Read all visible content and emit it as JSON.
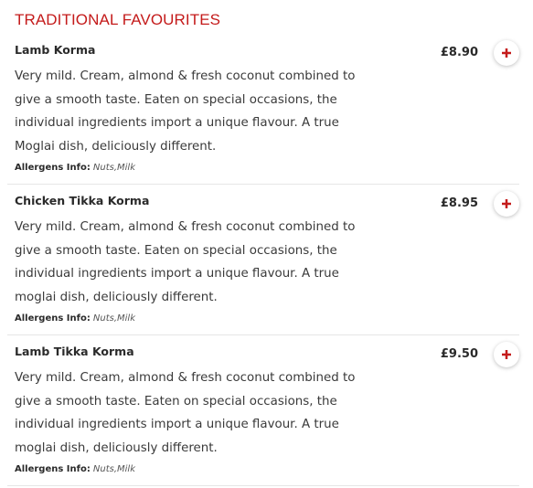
{
  "section": {
    "title": "TRADITIONAL FAVOURITES"
  },
  "accent_color": "#c41b1b",
  "items": [
    {
      "name": "Lamb Korma",
      "price": "£8.90",
      "description": "Very mild. Cream, almond & fresh coconut combined to give a smooth taste. Eaten on special occasions, the individual ingredients import a unique flavour. A true Moglai dish, deliciously different.",
      "allergens_label": "Allergens Info:",
      "allergens": "Nuts,Milk",
      "add_icon": "plus-icon"
    },
    {
      "name": "Chicken Tikka Korma",
      "price": "£8.95",
      "description": "Very mild. Cream, almond & fresh coconut combined to give a smooth taste. Eaten on special occasions, the individual ingredients import a unique flavour. A true moglai dish, deliciously different.",
      "allergens_label": "Allergens Info:",
      "allergens": "Nuts,Milk",
      "add_icon": "plus-icon"
    },
    {
      "name": "Lamb Tikka Korma",
      "price": "£9.50",
      "description": "Very mild. Cream, almond & fresh coconut combined to give a smooth taste. Eaten on special occasions, the individual ingredients import a unique flavour. A true moglai dish, deliciously different.",
      "allergens_label": "Allergens Info:",
      "allergens": "Nuts,Milk",
      "add_icon": "plus-icon"
    }
  ]
}
